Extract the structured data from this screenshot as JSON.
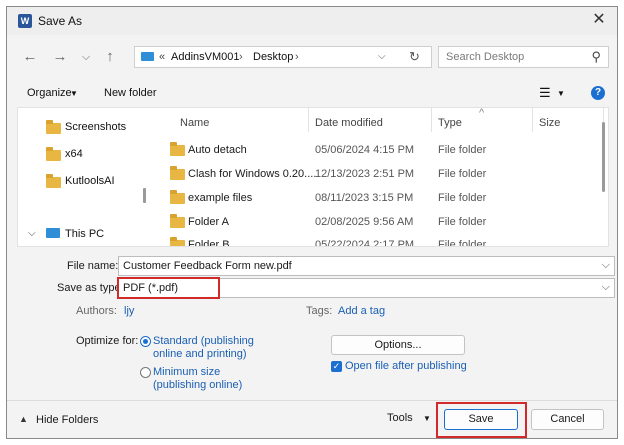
{
  "window": {
    "title": "Save As",
    "app_icon_letter": "W"
  },
  "nav": {
    "back_icon": "arrow-left-icon",
    "forward_icon": "arrow-right-icon",
    "recent_icon": "chevron-down-icon",
    "up_icon": "arrow-up-icon",
    "breadcrumb_overflow": "«",
    "breadcrumb": [
      "AddinsVM001",
      "Desktop"
    ],
    "breadcrumb_sep": "›",
    "search_placeholder": "Search Desktop"
  },
  "toolbar": {
    "organize": "Organize",
    "new_folder": "New folder",
    "view_icon": "list-view-icon",
    "help_icon": "help-icon",
    "help_glyph": "?"
  },
  "tree": [
    {
      "label": "Screenshots",
      "icon": "folder-icon"
    },
    {
      "label": "x64",
      "icon": "folder-icon"
    },
    {
      "label": "KutloolsAI",
      "icon": "folder-icon"
    },
    {
      "label": "This PC",
      "icon": "monitor-icon"
    }
  ],
  "columns": {
    "name": "Name",
    "date": "Date modified",
    "type": "Type",
    "size": "Size"
  },
  "files": [
    {
      "name": "Auto detach",
      "date": "05/06/2024 4:15 PM",
      "type": "File folder"
    },
    {
      "name": "Clash for Windows 0.20....",
      "date": "12/13/2023 2:51 PM",
      "type": "File folder"
    },
    {
      "name": "example files",
      "date": "08/11/2023 3:15 PM",
      "type": "File folder"
    },
    {
      "name": "Folder A",
      "date": "02/08/2025 9:56 AM",
      "type": "File folder"
    },
    {
      "name": "Folder B",
      "date": "05/22/2024 2:17 PM",
      "type": "File folder"
    }
  ],
  "form": {
    "file_name_label": "File name:",
    "file_name_value": "Customer Feedback Form new.pdf",
    "save_type_label": "Save as type:",
    "save_type_value": "PDF (*.pdf)",
    "authors_label": "Authors:",
    "authors_value": "ljy",
    "tags_label": "Tags:",
    "tags_value": "Add a tag",
    "optimize_label": "Optimize for:",
    "standard_line1": "Standard (publishing",
    "standard_line2": "online and printing)",
    "minimum_line1": "Minimum size",
    "minimum_line2": "(publishing online)",
    "options_button": "Options...",
    "open_after_label": "Open file after publishing"
  },
  "footer": {
    "hide_folders": "Hide Folders",
    "tools": "Tools",
    "save": "Save",
    "cancel": "Cancel"
  },
  "colors": {
    "accent": "#1a6fd0",
    "highlight_border": "#d22a2a",
    "folder": "#e8b642"
  }
}
